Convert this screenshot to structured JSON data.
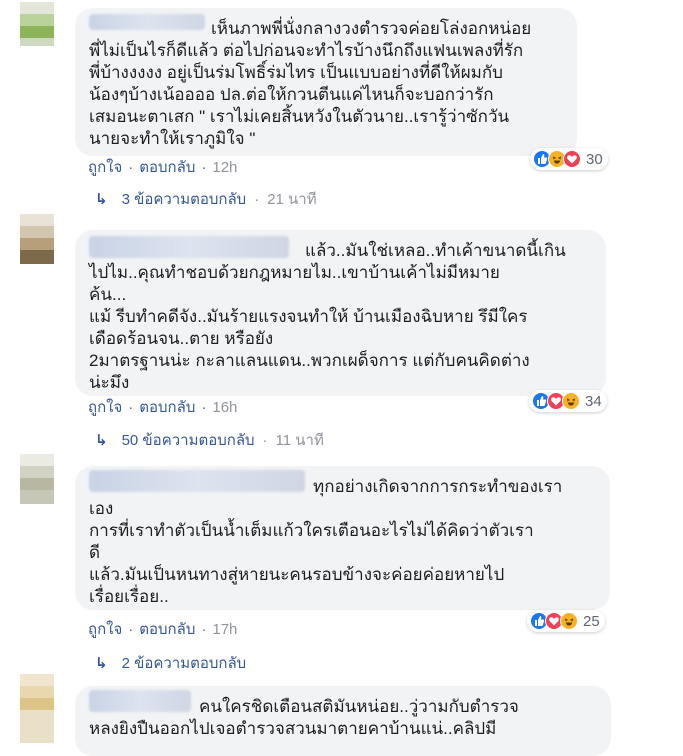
{
  "comments": [
    {
      "lines": [
        "เห็นภาพพี่นั่งกลางวงตำรวจค่อยโล่งอกหน่อย",
        "พี่ไม่เป็นไรก็ดีแล้ว ต่อไปก่อนจะทำไรบ้างนึกถึงแฟนเพลงที่รัก",
        "พี่บ้างงงงง อยู่เป็นร่มโพธิ์ร่มไทร เป็นแบบอย่างที่ดีให้ผมกับ",
        "น้องๆบ้างเน้ออออ ปล.ต่อให้กวนตีนแค่ไหนก็จะบอกว่ารัก",
        "เสมอนะตาเสก \" เราไม่เคยสิ้นหวังในตัวนาย..เรารู้ว่าซักวัน",
        "นายจะทำให้เราภูมิใจ \""
      ],
      "like": "ถูกใจ",
      "reply": "ตอบกลับ",
      "time": "12h",
      "reaction_count": "30",
      "replies_label": "3 ข้อความตอบกลับ",
      "replies_ago": "21 นาที"
    },
    {
      "lines": [
        "แล้ว..มันใช่เหลอ..ทำเค้าขนาดนี้เกิน",
        "ไปไม..คุณทำชอบด้วยกฎหมายไม..เขาบ้านเค้าไม่มีหมาย",
        "ค้น...",
        "แม้ รีบทำคดีจัง..มันร้ายแรงจนทำให้ บ้านเมืองฉิบหาย รึมีใคร",
        "เดือดร้อนจน..ตาย หรือยัง",
        "2มาตรฐานน่ะ กะลาแลนแดน..พวกเผด็จการ แต่กับคนคิดต่าง",
        "น่ะมึง"
      ],
      "like": "ถูกใจ",
      "reply": "ตอบกลับ",
      "time": "16h",
      "reaction_count": "34",
      "replies_label": "50 ข้อความตอบกลับ",
      "replies_ago": "11 นาที"
    },
    {
      "lines": [
        "ทุกอย่างเกิดจากการกระทำของเรา",
        "เอง",
        "การที่เราทำตัวเป็นน้ำเต็มแก้วใครเตือนอะไรไม่ได้คิดว่าตัวเรา",
        "ดี",
        "แล้ว.มันเป็นหนทางสู่หายนะคนรอบข้างจะค่อยค่อยหายไป",
        "เรื่อยเรื่อย.."
      ],
      "like": "ถูกใจ",
      "reply": "ตอบกลับ",
      "time": "17h",
      "reaction_count": "25",
      "replies_label": "2 ข้อความตอบกลับ",
      "replies_ago": ""
    },
    {
      "lines": [
        "คนใครชิดเตือนสติมันหน่อย..วู่วามกับตำรวจ",
        "หลงยิงปืนออกไปเจอตำรวจสวนมาตายคาบ้านแน่..คลิปมี"
      ]
    }
  ],
  "colors": {
    "link": "#365899",
    "bubble": "#f2f3f5",
    "like": "#1877f2",
    "love": "#f33e58",
    "haha": "#f7b125"
  }
}
